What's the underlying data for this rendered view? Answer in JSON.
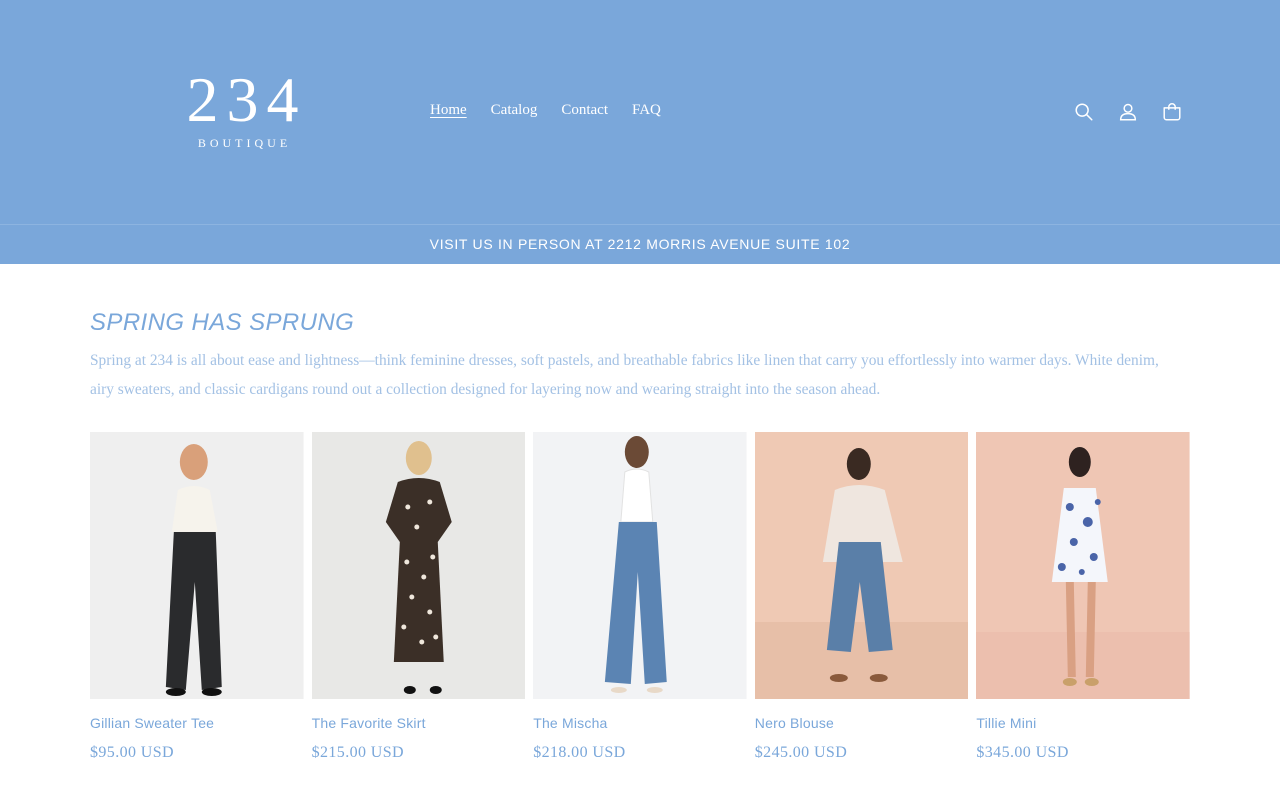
{
  "brand": {
    "number": "234",
    "subtitle": "BOUTIQUE"
  },
  "nav": {
    "items": [
      {
        "label": "Home",
        "active": true
      },
      {
        "label": "Catalog",
        "active": false
      },
      {
        "label": "Contact",
        "active": false
      },
      {
        "label": "FAQ",
        "active": false
      }
    ]
  },
  "header_icons": [
    "search-icon",
    "account-icon",
    "cart-icon"
  ],
  "announcement": "VISIT US IN PERSON AT 2212 MORRIS AVENUE SUITE 102",
  "collection": {
    "title": "SPRING HAS SPRUNG",
    "description": "Spring at 234 is all about ease and lightness—think feminine dresses, soft pastels, and breathable fabrics like linen that carry you effortlessly into warmer days. White denim, airy sweaters, and classic cardigans round out a collection designed for layering now and wearing straight into the season ahead."
  },
  "products": [
    {
      "name": "Gillian Sweater Tee",
      "price": "$95.00 USD"
    },
    {
      "name": "The Favorite Skirt",
      "price": "$215.00 USD"
    },
    {
      "name": "The Mischa",
      "price": "$218.00 USD"
    },
    {
      "name": "Nero Blouse",
      "price": "$245.00 USD"
    },
    {
      "name": "Tillie Mini",
      "price": "$345.00 USD"
    }
  ],
  "colors": {
    "brand_blue": "#7aa7da",
    "text_light_blue": "#a3c1e4",
    "white": "#ffffff"
  }
}
